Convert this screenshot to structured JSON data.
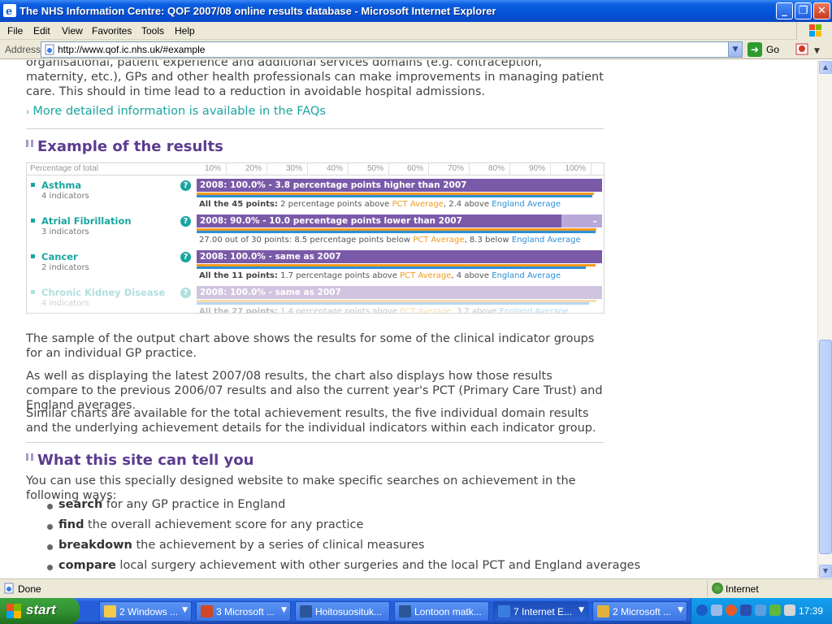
{
  "window": {
    "title": "The NHS Information Centre: QOF 2007/08 online results database - Microsoft Internet Explorer",
    "buttons": {
      "minimize": "_",
      "maximize": "❐",
      "close": "✕"
    }
  },
  "menu": [
    "File",
    "Edit",
    "View",
    "Favorites",
    "Tools",
    "Help"
  ],
  "address": {
    "label": "Address",
    "url": "http://www.qof.ic.nhs.uk/#example",
    "go": "Go"
  },
  "content": {
    "intro_partial": "organisational, patient experience and additional services domains (e.g. contraception, maternity, etc.), GPs and other health professionals can make improvements in managing patient care. This should in time lead to a reduction in avoidable hospital admissions.",
    "faq_link": "More detailed information is available in the FAQs",
    "example_heading": "Example of the results",
    "chart_header": "Percentage of total",
    "ticks": [
      "10%",
      "20%",
      "30%",
      "40%",
      "50%",
      "60%",
      "70%",
      "80%",
      "90%",
      "100%"
    ],
    "rows": [
      {
        "name": "Asthma",
        "indicators": "4 indicators",
        "bar_text": "2008: 100.0% - 3.8 percentage points higher than 2007",
        "sign": "+",
        "detail_bold": "All the 45 points:",
        "detail_a": " 2 percentage points above ",
        "pct_label": "PCT Average",
        "detail_b": ", 2.4  above ",
        "eng_label": "England Average"
      },
      {
        "name": "Atrial Fibrillation",
        "indicators": "3 indicators",
        "bar_text": "2008: 90.0% - 10.0 percentage points lower than 2007",
        "sign": "–",
        "detail_bold": "",
        "detail_a": "27.00 out of 30 points: 8.5 percentage points below ",
        "pct_label": "PCT Average",
        "detail_b": ", 8.3  below ",
        "eng_label": "England Average"
      },
      {
        "name": "Cancer",
        "indicators": "2 indicators",
        "bar_text": "2008: 100.0% - same as 2007",
        "sign": "=",
        "detail_bold": "All the 11 points:",
        "detail_a": " 1.7 percentage points above ",
        "pct_label": "PCT Average",
        "detail_b": ", 4  above ",
        "eng_label": "England Average"
      },
      {
        "name": "Chronic Kidney Disease",
        "indicators": "4 indicators",
        "bar_text": "2008: 100.0% - same as 2007",
        "sign": "=",
        "detail_bold": "All the 27 points:",
        "detail_a": " 1.4 percentage points above ",
        "pct_label": "PCT Average",
        "detail_b": ", 3.2  above ",
        "eng_label": "England Average"
      }
    ],
    "para1": "The sample of the output chart above shows the results for some of the clinical indicator groups for an individual GP practice.",
    "para2": "As well as displaying the latest 2007/08 results, the chart also displays how those results compare to the previous 2006/07 results and also the current year's PCT (Primary Care Trust) and England averages.",
    "para3": "Similar charts are available for the total achievement results, the five individual domain results and the underlying achievement details for the individual indicators within each indicator group.",
    "site_heading": "What this site can tell you",
    "site_intro": "You can use this specially designed website to make specific searches on achievement in the following ways:",
    "bullets": [
      {
        "kw": "search",
        "rest": " for any GP practice in England"
      },
      {
        "kw": "find",
        "rest": " the overall achievement score for any practice"
      },
      {
        "kw": "breakdown",
        "rest": " the achievement by a series of clinical measures"
      },
      {
        "kw": "compare",
        "rest": " local surgery achievement with other surgeries and the local PCT and England averages"
      }
    ]
  },
  "chart_data": {
    "type": "bar",
    "xlabel": "Percentage of total",
    "xlim": [
      0,
      100
    ],
    "categories": [
      "Asthma",
      "Atrial Fibrillation",
      "Cancer",
      "Chronic Kidney Disease"
    ],
    "series": [
      {
        "name": "2008",
        "values": [
          100.0,
          90.0,
          100.0,
          100.0
        ]
      },
      {
        "name": "PCT Average",
        "values": [
          98.0,
          98.5,
          98.3,
          98.6
        ]
      },
      {
        "name": "England Average",
        "values": [
          97.6,
          98.3,
          96.0,
          96.8
        ]
      }
    ]
  },
  "status": {
    "text": "Done",
    "zone": "Internet"
  },
  "taskbar": {
    "start": "start",
    "items": [
      {
        "label": "2 Windows ...",
        "active": false
      },
      {
        "label": "3 Microsoft ...",
        "active": false
      },
      {
        "label": "Hoitosuosituk...",
        "active": false
      },
      {
        "label": "Lontoon matk...",
        "active": false
      },
      {
        "label": "7 Internet E...",
        "active": true
      },
      {
        "label": "2 Microsoft ...",
        "active": false
      }
    ],
    "clock": "17:39"
  },
  "colors": {
    "accent_purple": "#7a5aa8",
    "teal": "#1aa5a0",
    "pct_orange": "#f39a1e",
    "england_blue": "#2b8fd8"
  }
}
